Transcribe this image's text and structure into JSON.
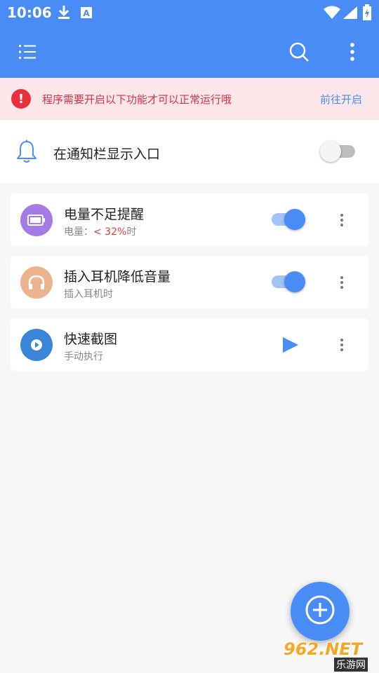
{
  "status_bar": {
    "time": "10:06",
    "icons": [
      "download-icon",
      "font-icon",
      "wifi-icon",
      "signal-icon",
      "battery-charging-icon"
    ]
  },
  "toolbar": {
    "menu_icon": "menu-list-icon",
    "search_icon": "search-icon",
    "more_icon": "more-vert-icon"
  },
  "warning": {
    "text": "程序需要开启以下功能才可以正常运行哦",
    "action": "前往开启",
    "icon": "alert-icon",
    "color": "#e8303d"
  },
  "notification_row": {
    "label": "在通知栏显示入口",
    "enabled": false,
    "icon": "bell-icon"
  },
  "tasks": [
    {
      "title": "电量不足提醒",
      "subtitle_prefix": "电量：",
      "subtitle_value": "< 32%",
      "subtitle_suffix": "时",
      "icon": "battery-icon",
      "icon_bg": "#a57be6",
      "control": "switch",
      "enabled": true
    },
    {
      "title": "插入耳机降低音量",
      "subtitle": "插入耳机时",
      "icon": "headphones-icon",
      "icon_bg": "#ebb48f",
      "control": "switch",
      "enabled": true
    },
    {
      "title": "快速截图",
      "subtitle": "手动执行",
      "icon": "screenshot-icon",
      "icon_bg": "#3b86d8",
      "control": "play",
      "enabled": null
    }
  ],
  "fab": {
    "icon": "add-icon"
  },
  "watermark": {
    "logo": "962.NET",
    "sub": "乐游网"
  },
  "colors": {
    "primary": "#4a8cf5",
    "warning_bg": "#fde6ea",
    "warning_text": "#d53443",
    "background": "#f7f7f7"
  }
}
